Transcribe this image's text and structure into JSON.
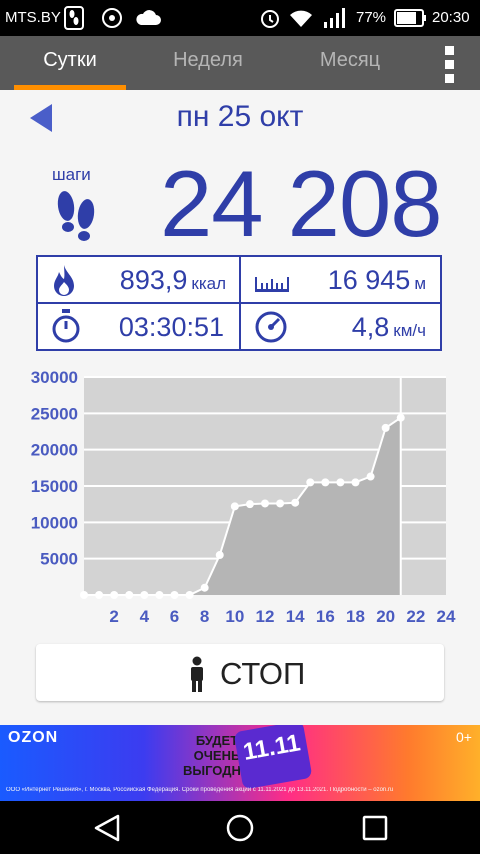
{
  "status_bar": {
    "carrier": "MTS.BY",
    "battery_percent": "77%",
    "time": "20:30"
  },
  "tabs": [
    {
      "label": "Сутки",
      "active": true
    },
    {
      "label": "Неделя",
      "active": false
    },
    {
      "label": "Месяц",
      "active": false
    }
  ],
  "date": "пн 25 окт",
  "steps": {
    "label": "шаги",
    "value": "24 208"
  },
  "stats": {
    "calories": {
      "value": "893,9",
      "unit": "ккал"
    },
    "distance": {
      "value": "16 945",
      "unit": "м"
    },
    "duration": {
      "value": "03:30:51"
    },
    "speed": {
      "value": "4,8",
      "unit": "км/ч"
    }
  },
  "chart_data": {
    "type": "area",
    "x": [
      0,
      1,
      2,
      3,
      4,
      5,
      6,
      7,
      8,
      9,
      10,
      11,
      12,
      13,
      14,
      15,
      16,
      17,
      18,
      19,
      20,
      21
    ],
    "values": [
      0,
      0,
      0,
      0,
      0,
      0,
      0,
      0,
      1000,
      5500,
      12200,
      12500,
      12600,
      12600,
      12700,
      15500,
      15500,
      15500,
      15500,
      16300,
      23000,
      24400
    ],
    "x_ticks": [
      "2",
      "4",
      "6",
      "8",
      "10",
      "12",
      "14",
      "16",
      "18",
      "20",
      "22",
      "24"
    ],
    "y_ticks": [
      "5000",
      "10000",
      "15000",
      "20000",
      "25000",
      "30000"
    ],
    "xlim": [
      0,
      24
    ],
    "ylim": [
      0,
      30000
    ],
    "grid": true,
    "current_hour": 21,
    "colors": {
      "plot_bg": "#d3d3d3",
      "area": "#b5b5b5",
      "line": "#ffffff",
      "tick_label": "#4a5bc0"
    }
  },
  "stop_button": {
    "label": "СТОП"
  },
  "ad": {
    "brand": "OZON",
    "age": "0+",
    "slogan": [
      "БУДЕТ",
      "ОЧЕНЬ",
      "ВЫГОДНО"
    ],
    "badge": "11.11",
    "legal": "ООО «Интернет Решения», г. Москва, Российская Федерация. Сроки проведения акции с 11.11.2021 до 13.11.2021. Подробности – ozon.ru"
  },
  "colors": {
    "accent": "#ff8f00",
    "primary": "#2f3ea8",
    "tabbar": "#595959"
  },
  "icons": [
    "back-arrow-icon",
    "footprints-icon",
    "flame-icon",
    "ruler-icon",
    "stopwatch-icon",
    "speedometer-icon",
    "person-icon"
  ]
}
